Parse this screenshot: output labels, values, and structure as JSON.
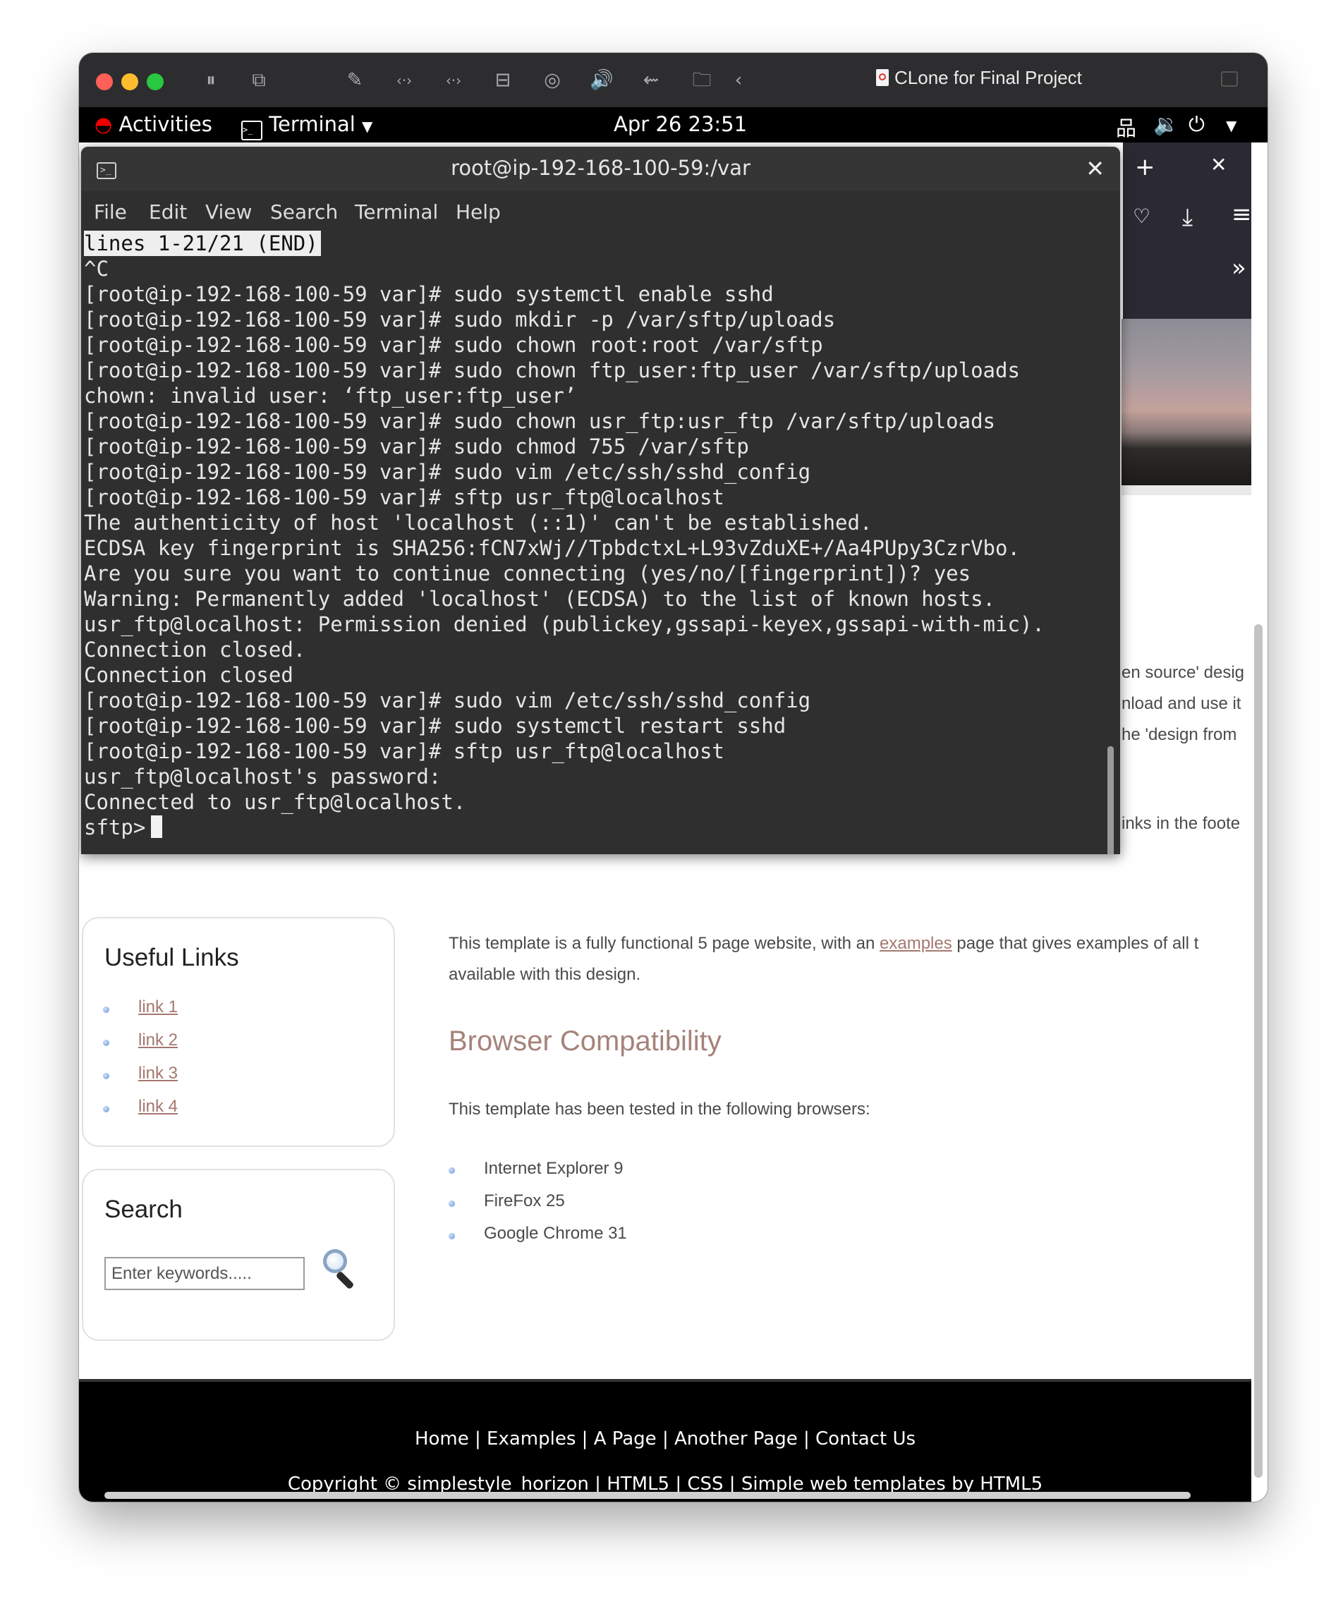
{
  "window": {
    "title": "CLone for Final Project",
    "toolbar_icons": [
      "pause-icon",
      "snapshot-icon",
      "wrench-icon",
      "code-arrows-icon",
      "code-arrows-icon",
      "drive-icon",
      "user-icon",
      "speaker-icon",
      "usb-icon",
      "folder-icon",
      "back-arrow-icon"
    ]
  },
  "gnome_bar": {
    "activities": "Activities",
    "app": "Terminal",
    "clock": "Apr 26  23:51"
  },
  "terminal": {
    "title": "root@ip-192-168-100-59:/var",
    "menu": [
      "File",
      "Edit",
      "View",
      "Search",
      "Terminal",
      "Help"
    ],
    "status_line": "lines 1-21/21 (END)",
    "lines": [
      "^C",
      "[root@ip-192-168-100-59 var]# sudo systemctl enable sshd",
      "[root@ip-192-168-100-59 var]# sudo mkdir -p /var/sftp/uploads",
      "[root@ip-192-168-100-59 var]# sudo chown root:root /var/sftp",
      "[root@ip-192-168-100-59 var]# sudo chown ftp_user:ftp_user /var/sftp/uploads",
      "chown: invalid user: ‘ftp_user:ftp_user’",
      "[root@ip-192-168-100-59 var]# sudo chown usr_ftp:usr_ftp /var/sftp/uploads",
      "[root@ip-192-168-100-59 var]# sudo chmod 755 /var/sftp",
      "[root@ip-192-168-100-59 var]# sudo vim /etc/ssh/sshd_config",
      "[root@ip-192-168-100-59 var]# sftp usr_ftp@localhost",
      "The authenticity of host 'localhost (::1)' can't be established.",
      "ECDSA key fingerprint is SHA256:fCN7xWj//TpbdctxL+L93vZduXE+/Aa4PUpy3CzrVbo.",
      "Are you sure you want to continue connecting (yes/no/[fingerprint])? yes",
      "Warning: Permanently added 'localhost' (ECDSA) to the list of known hosts.",
      "usr_ftp@localhost: Permission denied (publickey,gssapi-keyex,gssapi-with-mic).",
      "Connection closed.",
      "Connection closed",
      "[root@ip-192-168-100-59 var]# sudo vim /etc/ssh/sshd_config",
      "[root@ip-192-168-100-59 var]# sudo systemctl restart sshd",
      "[root@ip-192-168-100-59 var]# sftp usr_ftp@localhost",
      "usr_ftp@localhost's password:",
      "Connected to usr_ftp@localhost."
    ],
    "prompt": "sftp>"
  },
  "page": {
    "fragments": [
      "en source' desig",
      "nload and use it",
      "he 'design from",
      "inks in the foote"
    ],
    "useful_links": {
      "title": "Useful Links",
      "links": [
        "link 1",
        "link 2",
        "link 3",
        "link 4"
      ]
    },
    "search": {
      "title": "Search",
      "placeholder": "Enter keywords....."
    },
    "intro_before": "This template is a fully functional 5 page website, with an ",
    "intro_link": "examples",
    "intro_after": " page that gives examples of all t",
    "intro_line2": "available with this design.",
    "compat_title": "Browser Compatibility",
    "compat_text": "This template has been tested in the following browsers:",
    "browsers": [
      "Internet Explorer 9",
      "FireFox 25",
      "Google Chrome 31"
    ],
    "footer": {
      "nav": [
        "Home",
        "Examples",
        "A Page",
        "Another Page",
        "Contact Us"
      ],
      "separator": "|",
      "copyright": "Copyright © simplestyle_horizon | HTML5 | CSS | Simple web templates by HTML5"
    }
  },
  "colors": {
    "link": "#a5786f",
    "heading": "#a5837a",
    "terminal_bg": "#2f2f2f"
  }
}
